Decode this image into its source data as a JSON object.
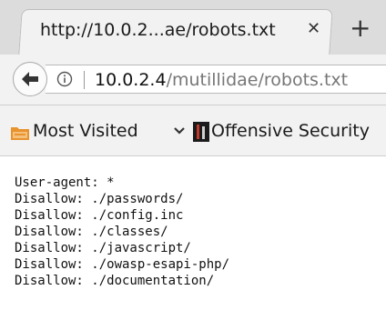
{
  "tab": {
    "title": "http://10.0.2...ae/robots.txt",
    "close_icon": "close-icon",
    "new_tab_icon": "plus-icon"
  },
  "navigation": {
    "back_icon": "back-arrow-icon",
    "info_icon": "info-icon",
    "url_host": "10.0.2.4",
    "url_path": "/mutillidae/robots.txt"
  },
  "bookmarks": {
    "items": [
      {
        "label": "Most Visited",
        "icon": "folder-icon",
        "has_dropdown": true
      },
      {
        "label": "Offensive Security",
        "icon": "offensive-security-icon"
      }
    ]
  },
  "page": {
    "lines": [
      "User-agent: *",
      "Disallow: ./passwords/",
      "Disallow: ./config.inc",
      "Disallow: ./classes/",
      "Disallow: ./javascript/",
      "Disallow: ./owasp-esapi-php/",
      "Disallow: ./documentation/"
    ]
  },
  "colors": {
    "chrome_background": "#f2f2f2",
    "url_path_gray": "#777777",
    "folder_orange": "#e8932e"
  }
}
